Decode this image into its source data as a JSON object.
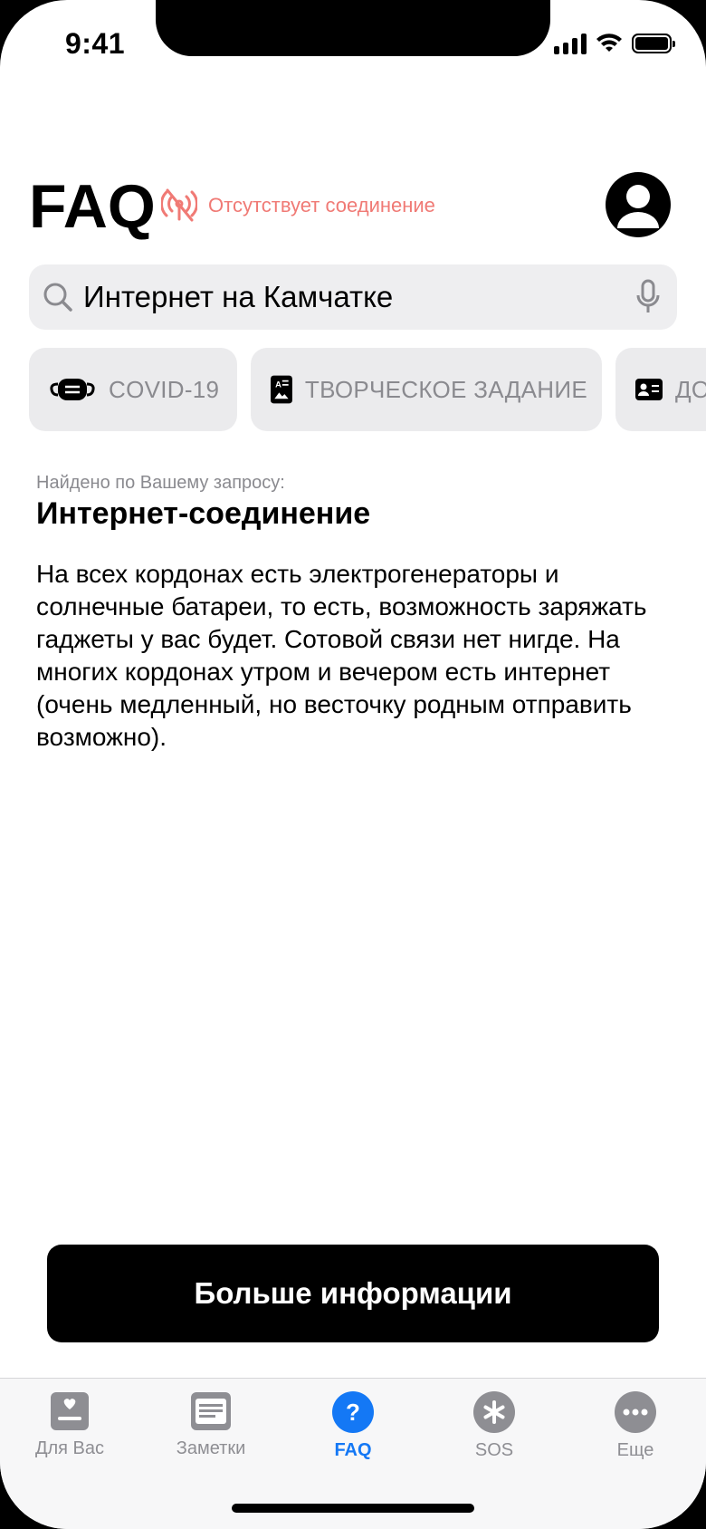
{
  "status_bar": {
    "time": "9:41"
  },
  "header": {
    "title": "FAQ",
    "connection_status": "Отсутствует соединение"
  },
  "search": {
    "value": "Интернет на Камчатке",
    "placeholder": ""
  },
  "chips": [
    {
      "label": "COVID-19",
      "icon": "mask-icon"
    },
    {
      "label": "ТВОРЧЕСКОЕ ЗАДАНИЕ",
      "icon": "creative-task-icon"
    },
    {
      "label": "ДО",
      "icon": "id-card-icon"
    }
  ],
  "result": {
    "found_label": "Найдено по Вашему запросу:",
    "title": "Интернет-соединение",
    "body": "На всех кордонах есть электрогенераторы и солнечные батареи, то есть, возможность заряжать гаджеты у вас будет. Сотовой связи нет нигде. На многих кордонах утром и вечером есть интернет (очень медленный, но весточку родным отправить возможно)."
  },
  "more_button": {
    "label": "Больше информации"
  },
  "tabbar": {
    "items": [
      {
        "label": "Для Вас",
        "icon": "for-you-icon",
        "active": false
      },
      {
        "label": "Заметки",
        "icon": "notes-icon",
        "active": false
      },
      {
        "label": "FAQ",
        "icon": "question-icon",
        "active": true
      },
      {
        "label": "SOS",
        "icon": "sos-icon",
        "active": false
      },
      {
        "label": "Еще",
        "icon": "more-icon",
        "active": false
      }
    ]
  },
  "colors": {
    "accent": "#1478f5",
    "offline_red": "#f07a75",
    "chip_bg": "#ebebed",
    "search_bg": "#eeeef0"
  }
}
